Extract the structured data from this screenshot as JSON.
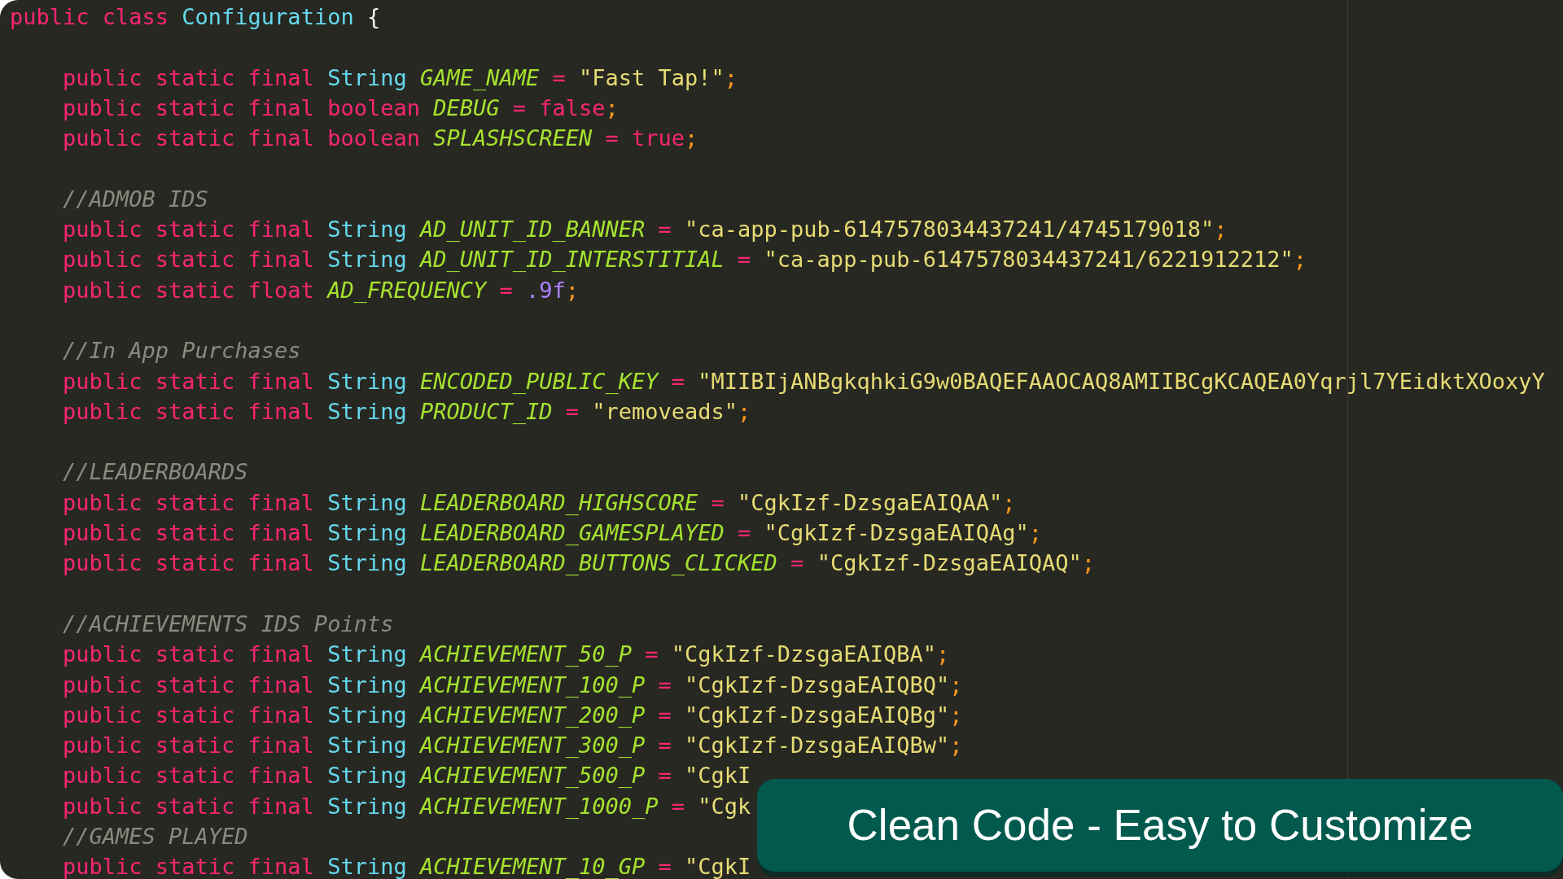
{
  "editor": {
    "lines": [
      {
        "kind": "code",
        "tokens": [
          {
            "text": "public class ",
            "kind": "keyword"
          },
          {
            "text": "Configuration",
            "kind": "type"
          },
          {
            "text": " {",
            "kind": "plain"
          }
        ]
      },
      {
        "kind": "blank"
      },
      {
        "kind": "code",
        "tokens": [
          {
            "text": "    public static final ",
            "kind": "keyword"
          },
          {
            "text": "String ",
            "kind": "type"
          },
          {
            "text": "GAME_NAME",
            "kind": "name"
          },
          {
            "text": " = ",
            "kind": "keyword"
          },
          {
            "text": "\"Fast Tap!\"",
            "kind": "string"
          },
          {
            "text": ";",
            "kind": "punct"
          }
        ]
      },
      {
        "kind": "code",
        "tokens": [
          {
            "text": "    public static final boolean ",
            "kind": "keyword"
          },
          {
            "text": "DEBUG",
            "kind": "name"
          },
          {
            "text": " = false",
            "kind": "keyword"
          },
          {
            "text": ";",
            "kind": "punct"
          }
        ]
      },
      {
        "kind": "code",
        "tokens": [
          {
            "text": "    public static final boolean ",
            "kind": "keyword"
          },
          {
            "text": "SPLASHSCREEN",
            "kind": "name"
          },
          {
            "text": " = true",
            "kind": "keyword"
          },
          {
            "text": ";",
            "kind": "punct"
          }
        ]
      },
      {
        "kind": "blank"
      },
      {
        "kind": "code",
        "tokens": [
          {
            "text": "    //ADMOB IDS",
            "kind": "comment"
          }
        ]
      },
      {
        "kind": "code",
        "tokens": [
          {
            "text": "    public static final ",
            "kind": "keyword"
          },
          {
            "text": "String ",
            "kind": "type"
          },
          {
            "text": "AD_UNIT_ID_BANNER",
            "kind": "name"
          },
          {
            "text": " = ",
            "kind": "keyword"
          },
          {
            "text": "\"ca-app-pub-6147578034437241/4745179018\"",
            "kind": "string"
          },
          {
            "text": ";",
            "kind": "punct"
          }
        ]
      },
      {
        "kind": "code",
        "tokens": [
          {
            "text": "    public static final ",
            "kind": "keyword"
          },
          {
            "text": "String ",
            "kind": "type"
          },
          {
            "text": "AD_UNIT_ID_INTERSTITIAL",
            "kind": "name"
          },
          {
            "text": " = ",
            "kind": "keyword"
          },
          {
            "text": "\"ca-app-pub-6147578034437241/6221912212\"",
            "kind": "string"
          },
          {
            "text": ";",
            "kind": "punct"
          }
        ]
      },
      {
        "kind": "code",
        "tokens": [
          {
            "text": "    public static float ",
            "kind": "keyword"
          },
          {
            "text": "AD_FREQUENCY",
            "kind": "name"
          },
          {
            "text": " = ",
            "kind": "keyword"
          },
          {
            "text": ".9f",
            "kind": "number"
          },
          {
            "text": ";",
            "kind": "punct"
          }
        ]
      },
      {
        "kind": "blank"
      },
      {
        "kind": "code",
        "tokens": [
          {
            "text": "    //In App Purchases",
            "kind": "comment"
          }
        ]
      },
      {
        "kind": "code",
        "tokens": [
          {
            "text": "    public static final ",
            "kind": "keyword"
          },
          {
            "text": "String ",
            "kind": "type"
          },
          {
            "text": "ENCODED_PUBLIC_KEY",
            "kind": "name"
          },
          {
            "text": " = ",
            "kind": "keyword"
          },
          {
            "text": "\"MIIBIjANBgkqhkiG9w0BAQEFAAOCAQ8AMIIBCgKCAQEA0Yqrjl7YEidktXOoxyY",
            "kind": "string"
          }
        ]
      },
      {
        "kind": "code",
        "tokens": [
          {
            "text": "    public static final ",
            "kind": "keyword"
          },
          {
            "text": "String ",
            "kind": "type"
          },
          {
            "text": "PRODUCT_ID",
            "kind": "name"
          },
          {
            "text": " = ",
            "kind": "keyword"
          },
          {
            "text": "\"removeads\"",
            "kind": "string"
          },
          {
            "text": ";",
            "kind": "punct"
          }
        ]
      },
      {
        "kind": "blank"
      },
      {
        "kind": "code",
        "tokens": [
          {
            "text": "    //LEADERBOARDS",
            "kind": "comment"
          }
        ]
      },
      {
        "kind": "code",
        "tokens": [
          {
            "text": "    public static final ",
            "kind": "keyword"
          },
          {
            "text": "String ",
            "kind": "type"
          },
          {
            "text": "LEADERBOARD_HIGHSCORE",
            "kind": "name"
          },
          {
            "text": " = ",
            "kind": "keyword"
          },
          {
            "text": "\"CgkIzf-DzsgaEAIQAA\"",
            "kind": "string"
          },
          {
            "text": ";",
            "kind": "punct"
          }
        ]
      },
      {
        "kind": "code",
        "tokens": [
          {
            "text": "    public static final ",
            "kind": "keyword"
          },
          {
            "text": "String ",
            "kind": "type"
          },
          {
            "text": "LEADERBOARD_GAMESPLAYED",
            "kind": "name"
          },
          {
            "text": " = ",
            "kind": "keyword"
          },
          {
            "text": "\"CgkIzf-DzsgaEAIQAg\"",
            "kind": "string"
          },
          {
            "text": ";",
            "kind": "punct"
          }
        ]
      },
      {
        "kind": "code",
        "tokens": [
          {
            "text": "    public static final ",
            "kind": "keyword"
          },
          {
            "text": "String ",
            "kind": "type"
          },
          {
            "text": "LEADERBOARD_BUTTONS_CLICKED",
            "kind": "name"
          },
          {
            "text": " = ",
            "kind": "keyword"
          },
          {
            "text": "\"CgkIzf-DzsgaEAIQAQ\"",
            "kind": "string"
          },
          {
            "text": ";",
            "kind": "punct"
          }
        ]
      },
      {
        "kind": "blank"
      },
      {
        "kind": "code",
        "tokens": [
          {
            "text": "    //ACHIEVEMENTS IDS Points",
            "kind": "comment"
          }
        ]
      },
      {
        "kind": "code",
        "tokens": [
          {
            "text": "    public static final ",
            "kind": "keyword"
          },
          {
            "text": "String ",
            "kind": "type"
          },
          {
            "text": "ACHIEVEMENT_50_P",
            "kind": "name"
          },
          {
            "text": " = ",
            "kind": "keyword"
          },
          {
            "text": "\"CgkIzf-DzsgaEAIQBA\"",
            "kind": "string"
          },
          {
            "text": ";",
            "kind": "punct"
          }
        ]
      },
      {
        "kind": "code",
        "tokens": [
          {
            "text": "    public static final ",
            "kind": "keyword"
          },
          {
            "text": "String ",
            "kind": "type"
          },
          {
            "text": "ACHIEVEMENT_100_P",
            "kind": "name"
          },
          {
            "text": " = ",
            "kind": "keyword"
          },
          {
            "text": "\"CgkIzf-DzsgaEAIQBQ\"",
            "kind": "string"
          },
          {
            "text": ";",
            "kind": "punct"
          }
        ]
      },
      {
        "kind": "code",
        "tokens": [
          {
            "text": "    public static final ",
            "kind": "keyword"
          },
          {
            "text": "String ",
            "kind": "type"
          },
          {
            "text": "ACHIEVEMENT_200_P",
            "kind": "name"
          },
          {
            "text": " = ",
            "kind": "keyword"
          },
          {
            "text": "\"CgkIzf-DzsgaEAIQBg\"",
            "kind": "string"
          },
          {
            "text": ";",
            "kind": "punct"
          }
        ]
      },
      {
        "kind": "code",
        "tokens": [
          {
            "text": "    public static final ",
            "kind": "keyword"
          },
          {
            "text": "String ",
            "kind": "type"
          },
          {
            "text": "ACHIEVEMENT_300_P",
            "kind": "name"
          },
          {
            "text": " = ",
            "kind": "keyword"
          },
          {
            "text": "\"CgkIzf-DzsgaEAIQBw\"",
            "kind": "string"
          },
          {
            "text": ";",
            "kind": "punct"
          }
        ]
      },
      {
        "kind": "code",
        "tokens": [
          {
            "text": "    public static final ",
            "kind": "keyword"
          },
          {
            "text": "String ",
            "kind": "type"
          },
          {
            "text": "ACHIEVEMENT_500_P",
            "kind": "name"
          },
          {
            "text": " = ",
            "kind": "keyword"
          },
          {
            "text": "\"CgkI",
            "kind": "string"
          }
        ]
      },
      {
        "kind": "code",
        "tokens": [
          {
            "text": "    public static final ",
            "kind": "keyword"
          },
          {
            "text": "String ",
            "kind": "type"
          },
          {
            "text": "ACHIEVEMENT_1000_P",
            "kind": "name"
          },
          {
            "text": " = ",
            "kind": "keyword"
          },
          {
            "text": "\"Cgk",
            "kind": "string"
          }
        ]
      },
      {
        "kind": "code",
        "tokens": [
          {
            "text": "    //GAMES PLAYED",
            "kind": "comment"
          }
        ]
      },
      {
        "kind": "code",
        "tokens": [
          {
            "text": "    public static final ",
            "kind": "keyword"
          },
          {
            "text": "String ",
            "kind": "type"
          },
          {
            "text": "ACHIEVEMENT_10_GP",
            "kind": "name"
          },
          {
            "text": " = ",
            "kind": "keyword"
          },
          {
            "text": "\"CgkI",
            "kind": "string"
          }
        ]
      }
    ]
  },
  "banner": {
    "text": "Clean Code - Easy to Customize"
  }
}
